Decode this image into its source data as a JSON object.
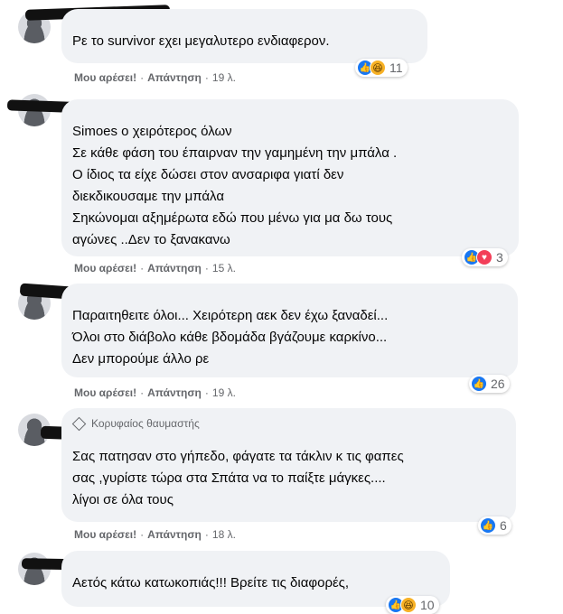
{
  "labels": {
    "like": "Μου αρέσει!",
    "reply": "Απάντηση",
    "dot": "·"
  },
  "comments": [
    {
      "name": "",
      "text": "Ρε το survivor εχει μεγαλυτερο ενδιαφερον.",
      "time": "19 λ.",
      "reactions": [
        "like",
        "haha"
      ],
      "count": "11"
    },
    {
      "name": "",
      "text": "Simoes ο χειρότερος όλων\nΣε κάθε φάση του έπαιρναν την γαμημένη την μπάλα .\nΟ ίδιος τα είχε δώσει στον ανσαριφα γιατί δεν\nδιεκδικουσαμε την μπάλα\nΣηκώνομαι αξημέρωτα εδώ που μένω για μα δω τους\nαγώνες ..Δεν το ξανακανω",
      "time": "15 λ.",
      "reactions": [
        "like",
        "love"
      ],
      "count": "3"
    },
    {
      "name": "",
      "text": "Παραιτηθειτε όλοι... Χειρότερη αεκ δεν έχω ξαναδεί...\nΌλοι στο διάβολο κάθε βδομάδα βγάζουμε καρκίνο...\nΔεν μπορούμε άλλο ρε",
      "time": "19 λ.",
      "reactions": [
        "like"
      ],
      "count": "26"
    },
    {
      "badge": "Κορυφαίος θαυμαστής",
      "name": "",
      "text": "Σας πατησαν στο γήπεδο, φάγατε τα τάκλιν κ τις φαπες\nσας ,γυρίστε τώρα στα Σπάτα να το παίξτε μάγκες....\nλίγοι σε όλα τους",
      "time": "18 λ.",
      "reactions": [
        "like"
      ],
      "count": "6"
    },
    {
      "name": "",
      "text": "Αετός κάτω κατωκοπιάς!!! Βρείτε τις διαφορές,",
      "time": "",
      "reactions": [
        "like",
        "haha"
      ],
      "count": "10"
    }
  ]
}
